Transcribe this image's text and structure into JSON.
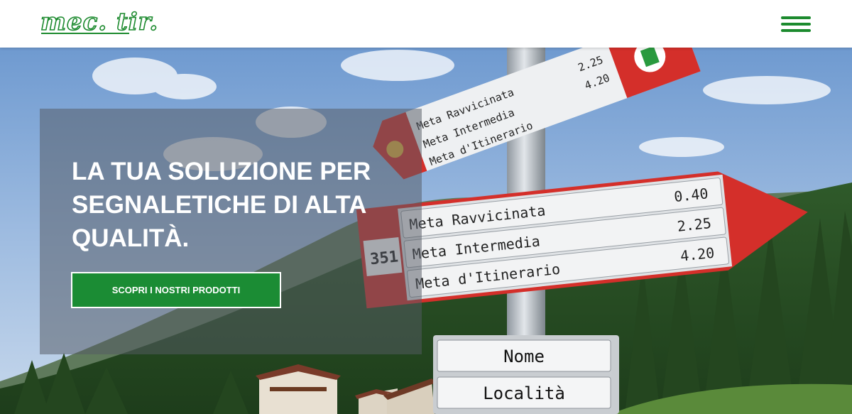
{
  "header": {
    "logo_text": "mec. tir.",
    "menu_icon": "hamburger-menu-icon",
    "brand_color": "#1c8a2e"
  },
  "hero": {
    "headline": "LA TUA SOLUZIONE PER SEGNALETICHE DI ALTA QUALITÀ.",
    "cta_label": "SCOPRI I NOSTRI PRODOTTI",
    "cta_color": "#1b8c34",
    "image": {
      "top_sign": {
        "rows": [
          "Meta Ravvicinata",
          "Meta Intermedia",
          "Meta d'Itinerario"
        ],
        "distances": [
          "2.25",
          "4.20"
        ]
      },
      "main_sign": {
        "number": "351",
        "rows": [
          "Meta Ravvicinata",
          "Meta Intermedia",
          "Meta d'Itinerario"
        ],
        "distances": [
          "0.40",
          "2.25",
          "4.20"
        ]
      },
      "bottom_sign": {
        "rows": [
          "Nome",
          "Località"
        ]
      }
    }
  }
}
